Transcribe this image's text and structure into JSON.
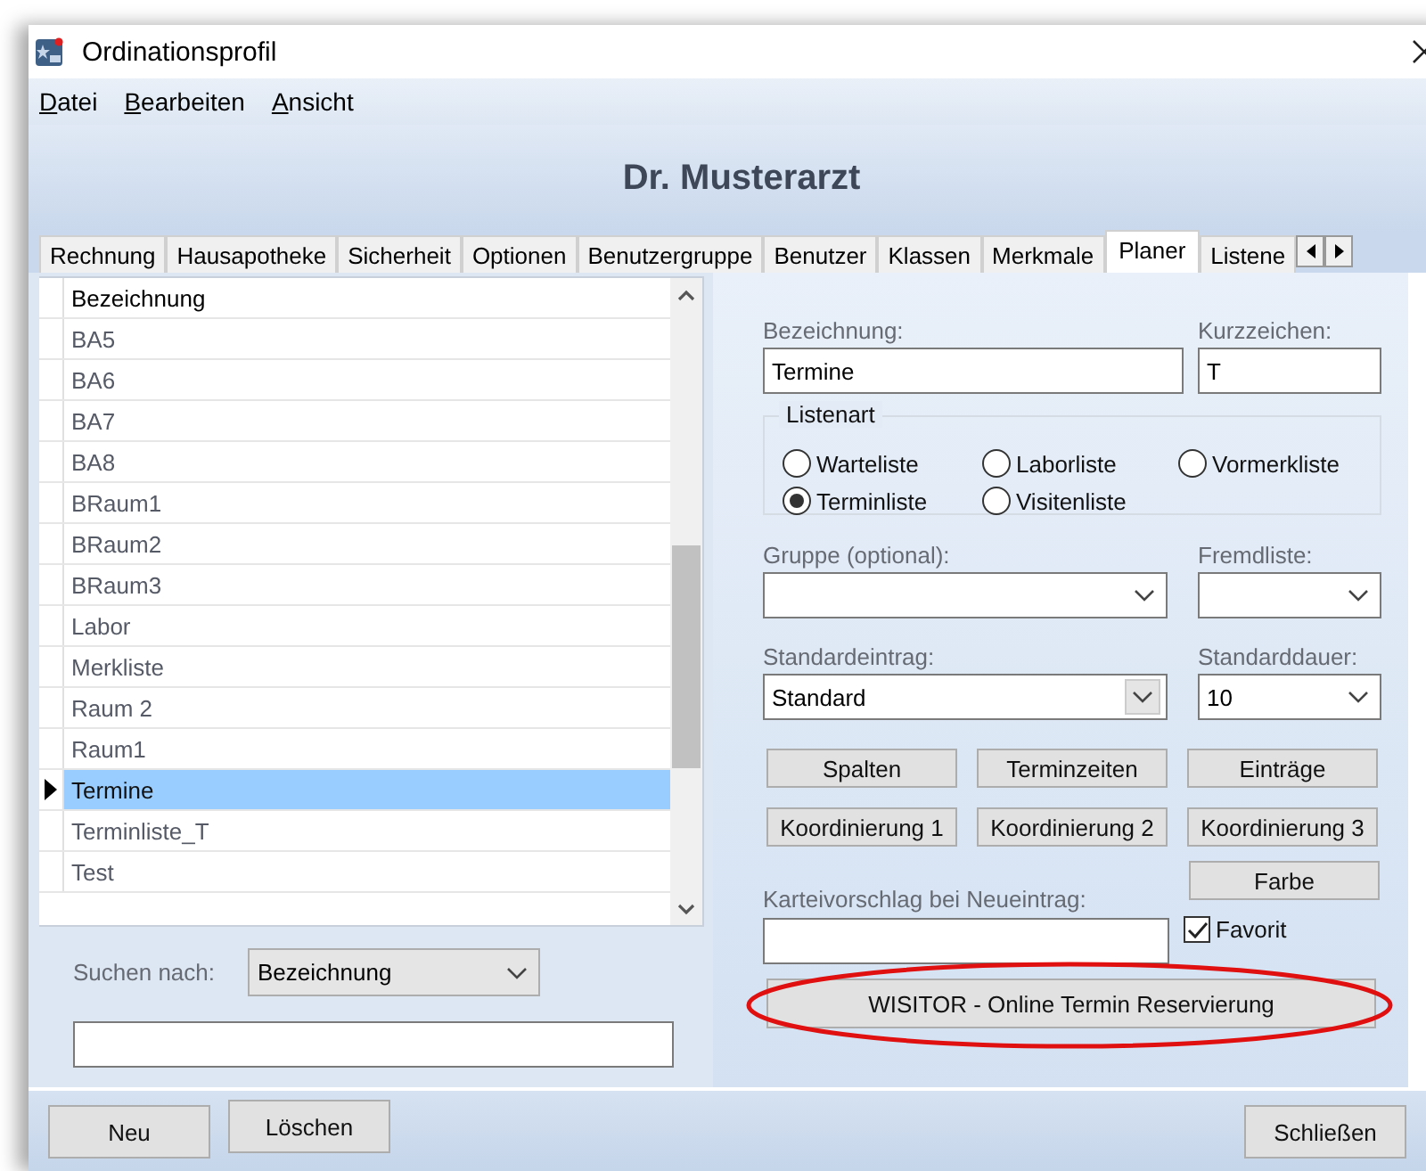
{
  "window": {
    "title": "Ordinationsprofil"
  },
  "menu": [
    {
      "label": "Datei"
    },
    {
      "label": "Bearbeiten"
    },
    {
      "label": "Ansicht"
    }
  ],
  "header": "Dr. Musterarzt",
  "tabs": [
    {
      "label": "Rechnung",
      "selected": false
    },
    {
      "label": "Hausapotheke",
      "selected": false
    },
    {
      "label": "Sicherheit",
      "selected": false
    },
    {
      "label": "Optionen",
      "selected": false
    },
    {
      "label": "Benutzergruppe",
      "selected": false
    },
    {
      "label": "Benutzer",
      "selected": false
    },
    {
      "label": "Klassen",
      "selected": false
    },
    {
      "label": "Merkmale",
      "selected": false
    },
    {
      "label": "Planer",
      "selected": true
    },
    {
      "label": "Listene",
      "selected": false
    }
  ],
  "list": {
    "column": "Bezeichnung",
    "rows": [
      {
        "label": "BA5",
        "selected": false
      },
      {
        "label": "BA6",
        "selected": false
      },
      {
        "label": "BA7",
        "selected": false
      },
      {
        "label": "BA8",
        "selected": false
      },
      {
        "label": "BRaum1",
        "selected": false
      },
      {
        "label": "BRaum2",
        "selected": false
      },
      {
        "label": "BRaum3",
        "selected": false
      },
      {
        "label": "Labor",
        "selected": false
      },
      {
        "label": "Merkliste",
        "selected": false
      },
      {
        "label": "Raum 2",
        "selected": false
      },
      {
        "label": "Raum1",
        "selected": false
      },
      {
        "label": "Termine",
        "selected": true
      },
      {
        "label": "Terminliste_T",
        "selected": false
      },
      {
        "label": "Test",
        "selected": false
      }
    ]
  },
  "search": {
    "label": "Suchen nach:",
    "field": "Bezeichnung"
  },
  "form": {
    "bezeichnung": {
      "label": "Bezeichnung:",
      "value": "Termine"
    },
    "kurzzeichen": {
      "label": "Kurzzeichen:",
      "value": "T"
    },
    "listenart": {
      "label": "Listenart",
      "options": [
        {
          "label": "Warteliste",
          "selected": false
        },
        {
          "label": "Laborliste",
          "selected": false
        },
        {
          "label": "Vormerkliste",
          "selected": false
        },
        {
          "label": "Terminliste",
          "selected": true
        },
        {
          "label": "Visitenliste",
          "selected": false
        }
      ]
    },
    "gruppe": {
      "label": "Gruppe (optional):"
    },
    "fremdliste": {
      "label": "Fremdliste:"
    },
    "standardeintrag": {
      "label": "Standardeintrag:",
      "value": "Standard"
    },
    "standarddauer": {
      "label": "Standarddauer:",
      "value": "10"
    },
    "buttons": [
      "Spalten",
      "Terminzeiten",
      "Einträge",
      "Koordinierung 1",
      "Koordinierung 2",
      "Koordinierung 3",
      "Farbe"
    ],
    "karteivorschlag": {
      "label": "Karteivorschlag bei Neueintrag:"
    },
    "favorit": {
      "label": "Favorit",
      "checked": true
    },
    "wisitor": {
      "label": "WISITOR - Online Termin Reservierung",
      "highlighted": true
    }
  },
  "footer": {
    "left": [
      "Neu",
      "Löschen"
    ],
    "right": "Schließen"
  }
}
